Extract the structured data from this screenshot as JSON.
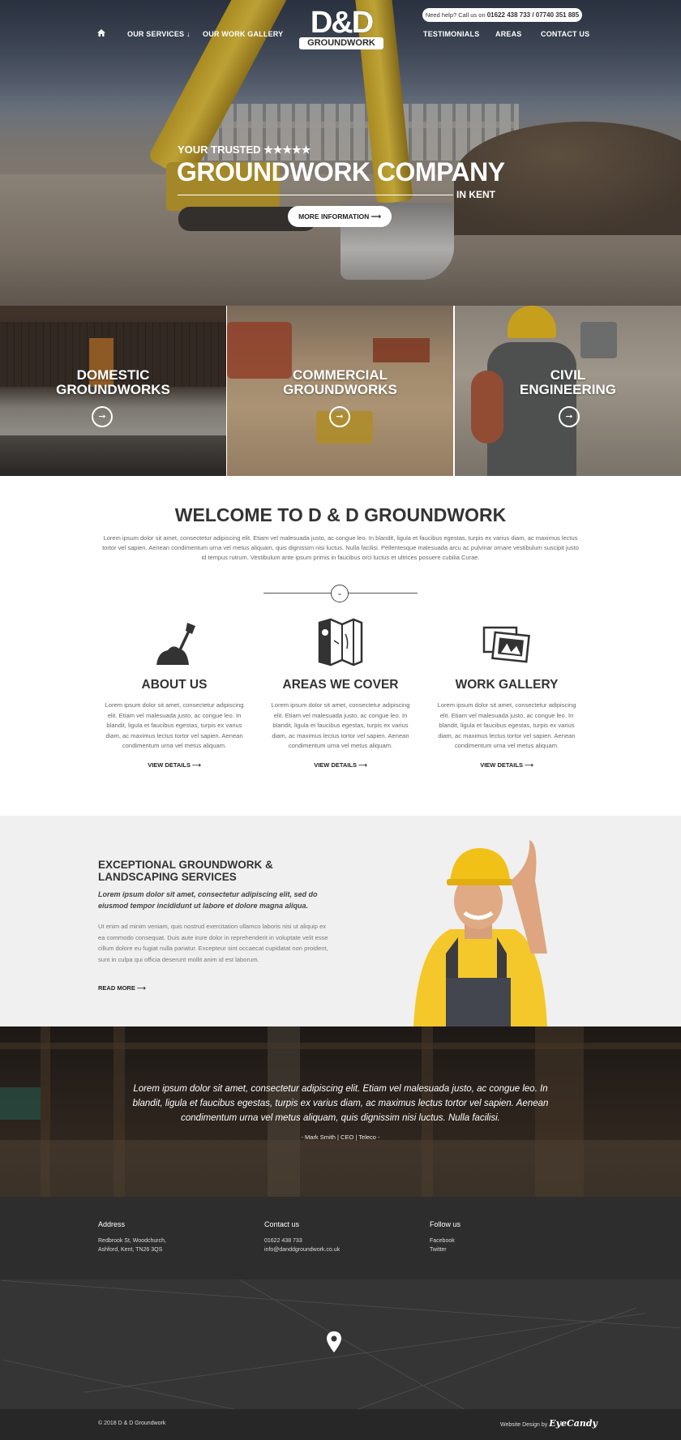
{
  "nav": {
    "home_icon": "home-icon",
    "services": "OUR SERVICES",
    "gallery": "OUR WORK GALLERY",
    "testimonials": "TESTIMONIALS",
    "areas": "AREAS",
    "contact": "CONTACT US"
  },
  "logo": {
    "top": "D&D",
    "bottom": "GROUNDWORK"
  },
  "help": {
    "prefix": "Need help? Call us on",
    "phones": "01622 438 733 / 07740 351 885"
  },
  "hero": {
    "line1": "YOUR TRUSTED ★★★★★",
    "line2": "GROUNDWORK COMPANY",
    "line3": "IN KENT",
    "button": "MORE INFORMATION"
  },
  "panels": [
    {
      "line1": "DOMESTIC",
      "line2": "GROUNDWORKS"
    },
    {
      "line1": "COMMERCIAL",
      "line2": "GROUNDWORKS"
    },
    {
      "line1": "CIVIL",
      "line2": "ENGINEERING"
    }
  ],
  "welcome": {
    "title": "WELCOME TO D & D GROUNDWORK",
    "text": "Lorem ipsum dolor sit amet, consectetur adipiscing elit. Etiam vel malesuada justo, ac congue leo. In blandit, ligula et faucibus egestas, turpis ex varius diam, ac maximus lectus tortor vel sapien. Aenean condimentum urna vel metus aliquam, quis dignissim nisi luctus. Nulla facilisi. Pellentesque malesuada arcu ac pulvinar ornare vestibulum suscipit justo id tempus rutrum. Vestibulum ante ipsum primis in faucibus orci luctus et ultrices posuere cubilia Curae."
  },
  "columns": [
    {
      "icon": "shovel-icon",
      "title": "ABOUT US",
      "text": "Lorem ipsum dolor sit amet, consectetur adipiscing elit. Etiam vel malesuada justo, ac congue leo. In blandit, ligula et faucibus egestas, turpis ex varius diam, ac maximus lectus tortor vel sapien. Aenean condimentum urna vel metus aliquam.",
      "link": "VIEW DETAILS"
    },
    {
      "icon": "map-icon",
      "title": "AREAS WE COVER",
      "text": "Lorem ipsum dolor sit amet, consectetur adipiscing elit. Etiam vel malesuada justo, ac congue leo. In blandit, ligula et faucibus egestas, turpis ex varius diam, ac maximus lectus tortor vel sapien. Aenean condimentum urna vel metus aliquam.",
      "link": "VIEW DETAILS"
    },
    {
      "icon": "photos-icon",
      "title": "WORK GALLERY",
      "text": "Lorem ipsum dolor sit amet, consectetur adipiscing elit. Etiam vel malesuada justo, ac congue leo. In blandit, ligula et faucibus egestas, turpis ex varius diam, ac maximus lectus tortor vel sapien. Aenean condimentum urna vel metus aliquam.",
      "link": "VIEW DETAILS"
    }
  ],
  "exceptional": {
    "title": "EXCEPTIONAL GROUNDWORK & LANDSCAPING SERVICES",
    "intro": "Lorem ipsum dolor sit amet, consectetur adipiscing elit, sed do eiusmod tempor incididunt ut labore et dolore magna aliqua.",
    "text": "Ut enim ad minim veniam, quis nostrud exercitation ullamco laboris nisi ut aliquip ex ea commodo consequat. Duis aute irure dolor in reprehenderit in voluptate velit esse cillum dolore eu fugiat nulla pariatur. Excepteur sint occaecat cupidatat non proident, sunt in culpa qui officia deserunt mollit anim id est laborum.",
    "link": "READ MORE"
  },
  "testimonial": {
    "quote": "Lorem ipsum dolor sit amet, consectetur adipiscing elit. Etiam vel malesuada justo, ac congue leo. In blandit, ligula et faucibus egestas, turpis ex varius diam, ac maximus lectus tortor vel sapien. Aenean condimentum urna vel metus aliquam, quis dignissim nisi luctus. Nulla facilisi.",
    "author": "- Mark Smith  |  CEO  |  Teleco -"
  },
  "footer": {
    "address_title": "Address",
    "address_line1": "Redbrook St, Woodchurch,",
    "address_line2": "Ashford, Kent, TN26 3QS",
    "contact_title": "Contact us",
    "phone": "01622 438 733",
    "email": "info@danddgroundwork.co.uk",
    "follow_title": "Follow us",
    "facebook": "Facebook",
    "twitter": "Twitter"
  },
  "bottom": {
    "copyright": "© 2018 D & D Groundwork",
    "credit_prefix": "Website Design by",
    "credit_brand": "EyeCandy"
  },
  "colors": {
    "dark": "#2d2d2d",
    "panel_bg": "#f0f0f0",
    "helmet": "#f1c40f"
  }
}
